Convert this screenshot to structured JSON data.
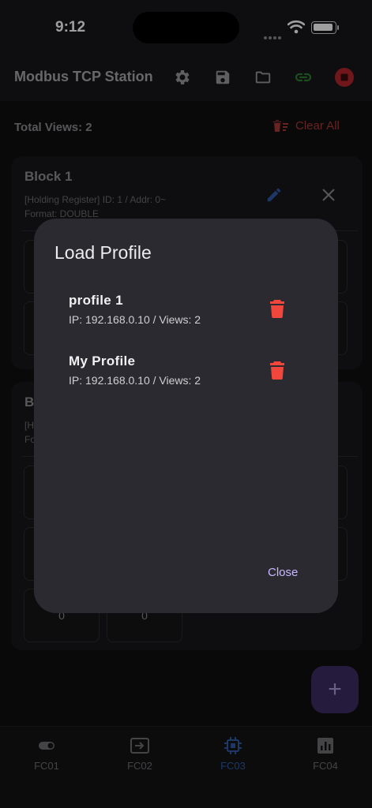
{
  "status_bar": {
    "time": "9:12"
  },
  "app_bar": {
    "title": "Modbus TCP Station",
    "icons": [
      "gear-icon",
      "save-icon",
      "folder-icon",
      "link-icon",
      "stop-icon"
    ]
  },
  "summary": {
    "total_views": "Total Views: 2",
    "clear_all": "Clear All"
  },
  "blocks": [
    {
      "title": "Block 1",
      "details": "[Holding Register] ID: 1 / Addr: 0~",
      "format": "Format: DOUBLE"
    },
    {
      "title": "B",
      "details": "[H",
      "format": "Fo",
      "values": [
        "0",
        "0"
      ]
    }
  ],
  "dialog": {
    "title": "Load Profile",
    "profiles": [
      {
        "name": "profile 1",
        "info": "IP: 192.168.0.10 / Views: 2"
      },
      {
        "name": "My Profile",
        "info": "IP: 192.168.0.10 / Views: 2"
      }
    ],
    "close_label": "Close"
  },
  "fab": {
    "label": "+"
  },
  "bottom_nav": {
    "items": [
      {
        "label": "FC01",
        "icon": "toggle-icon"
      },
      {
        "label": "FC02",
        "icon": "input-icon"
      },
      {
        "label": "FC03",
        "icon": "chip-icon"
      },
      {
        "label": "FC04",
        "icon": "bar-chart-icon"
      }
    ],
    "active": "FC03"
  },
  "colors": {
    "accent": "#c9b8ff",
    "danger": "#f0463b",
    "link": "#2e7d32",
    "active_nav": "#2f5aa6"
  }
}
